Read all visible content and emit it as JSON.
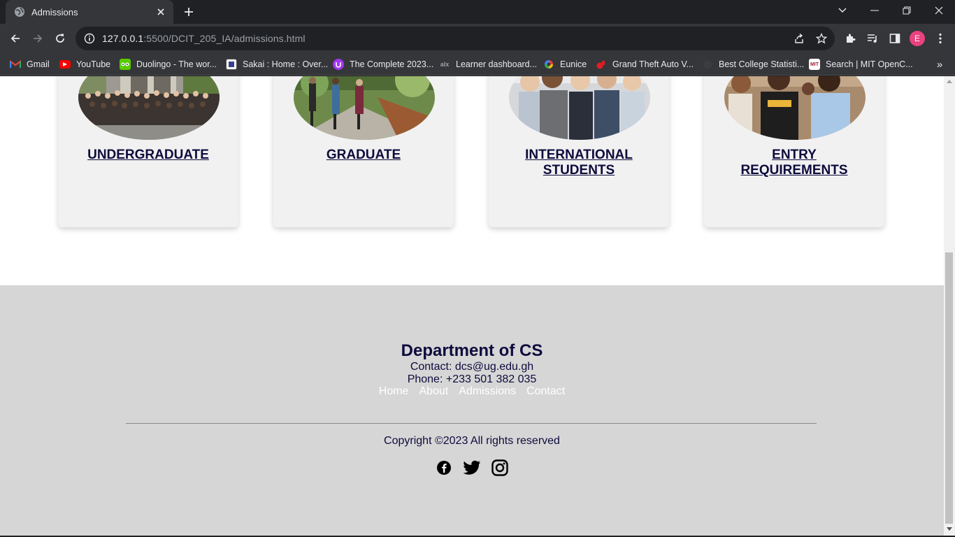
{
  "browser": {
    "tab_title": "Admissions",
    "url_host": "127.0.0.1",
    "url_rest": ":5500/DCIT_205_IA/admissions.html",
    "profile_initial": "E",
    "bookmarks": [
      {
        "label": "Gmail",
        "icon": "gmail-icon",
        "color": "#ea4335"
      },
      {
        "label": "YouTube",
        "icon": "youtube-icon",
        "color": "#ff0000"
      },
      {
        "label": "Duolingo - The wor...",
        "icon": "duolingo-icon",
        "color": "#58cc02"
      },
      {
        "label": "Sakai : Home : Over...",
        "icon": "sakai-icon",
        "color": "#ffffff"
      },
      {
        "label": "The Complete 2023...",
        "icon": "udemy-icon",
        "color": "#a435f0"
      },
      {
        "label": "Learner dashboard...",
        "icon": "alx-icon",
        "color": "#444444"
      },
      {
        "label": "Eunice",
        "icon": "eunice-icon",
        "color": "#4285f4"
      },
      {
        "label": "Grand Theft Auto V...",
        "icon": "gta-icon",
        "color": "#e01e26"
      },
      {
        "label": "Best College Statisti...",
        "icon": "globe-icon",
        "color": "#3c3c3c"
      },
      {
        "label": "Search | MIT OpenC...",
        "icon": "mit-icon",
        "color": "#a31f34"
      }
    ]
  },
  "cards": [
    {
      "title_line1": "UNDERGRADUATE",
      "title_line2": ""
    },
    {
      "title_line1": "GRADUATE",
      "title_line2": ""
    },
    {
      "title_line1": "INTERNATIONAL",
      "title_line2": "STUDENTS"
    },
    {
      "title_line1": "ENTRY",
      "title_line2": "REQUIREMENTS"
    }
  ],
  "footer": {
    "department": "Department of CS",
    "contact": "Contact: dcs@ug.edu.gh",
    "phone": "Phone: +233 501 382 035",
    "nav": [
      "Home",
      "About",
      "Admissions",
      "Contact"
    ],
    "copyright": "Copyright ©2023 All rights reserved",
    "social_icons": [
      "facebook-icon",
      "twitter-icon",
      "instagram-icon"
    ]
  },
  "colors": {
    "heading": "#0e0b3d",
    "footer_bg": "#d6d6d6",
    "card_bg": "#f1f1f1"
  }
}
